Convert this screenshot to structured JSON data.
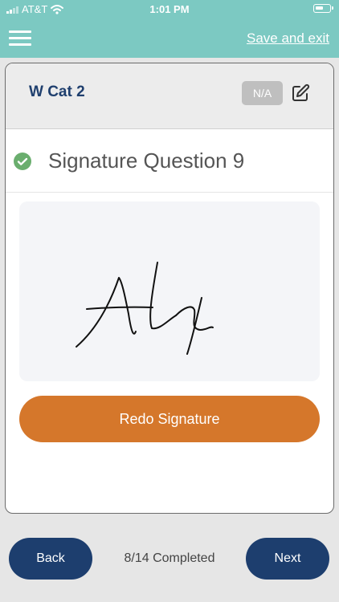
{
  "status_bar": {
    "carrier": "AT&T",
    "time": "1:01 PM"
  },
  "header": {
    "save_exit_label": "Save and exit"
  },
  "card": {
    "section_title": "W Cat 2",
    "na_label": "N/A",
    "question_title": "Signature Question 9",
    "redo_label": "Redo Signature"
  },
  "footer": {
    "back_label": "Back",
    "progress_text": "8/14 Completed",
    "next_label": "Next"
  },
  "colors": {
    "header_bg": "#7cc9c2",
    "title_blue": "#1f3f6e",
    "accent_orange": "#d5772b",
    "nav_button": "#1d3e6e",
    "check_green": "#6aae6e"
  },
  "icons": {
    "menu": "hamburger-menu-icon",
    "edit": "edit-pencil-icon",
    "complete": "check-circle-icon",
    "wifi": "wifi-icon",
    "battery": "battery-icon"
  }
}
